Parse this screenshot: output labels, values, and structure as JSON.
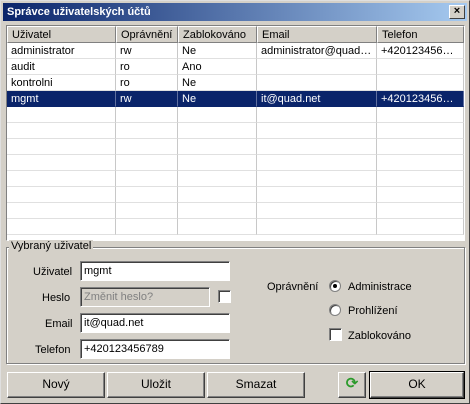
{
  "window": {
    "title": "Správce uživatelských účtů",
    "close_label": "×"
  },
  "table": {
    "columns": [
      "Uživatel",
      "Oprávnění",
      "Zablokováno",
      "Email",
      "Telefon"
    ],
    "rows": [
      [
        "administrator",
        "rw",
        "Ne",
        "administrator@quad....",
        "+420123456789"
      ],
      [
        "audit",
        "ro",
        "Ano",
        "",
        ""
      ],
      [
        "kontrolni",
        "ro",
        "Ne",
        "",
        ""
      ],
      [
        "mgmt",
        "rw",
        "Ne",
        "it@quad.net",
        "+420123456789"
      ]
    ],
    "selected_row": 3,
    "empty_rows": 8
  },
  "selected_user": {
    "group_title": "Vybraný uživatel",
    "username_label": "Uživatel",
    "username_value": "mgmt",
    "password_label": "Heslo",
    "password_placeholder": "Změnit heslo?",
    "email_label": "Email",
    "email_value": "it@quad.net",
    "phone_label": "Telefon",
    "phone_value": "+420123456789",
    "permission_label": "Oprávnění",
    "perm_admin_label": "Administrace",
    "perm_view_label": "Prohlížení",
    "perm_selected": "Administrace",
    "blocked_label": "Zablokováno",
    "blocked_checked": false,
    "password_checkbox_checked": false
  },
  "buttons": {
    "new_label": "Nový",
    "save_label": "Uložit",
    "delete_label": "Smazat",
    "refresh_icon": "refresh-icon",
    "ok_label": "OK"
  },
  "colors": {
    "selection": "#0a246a",
    "title_gradient_start": "#0a246a",
    "title_gradient_end": "#a6caf0",
    "refresh_icon": "#2a9a2a"
  }
}
